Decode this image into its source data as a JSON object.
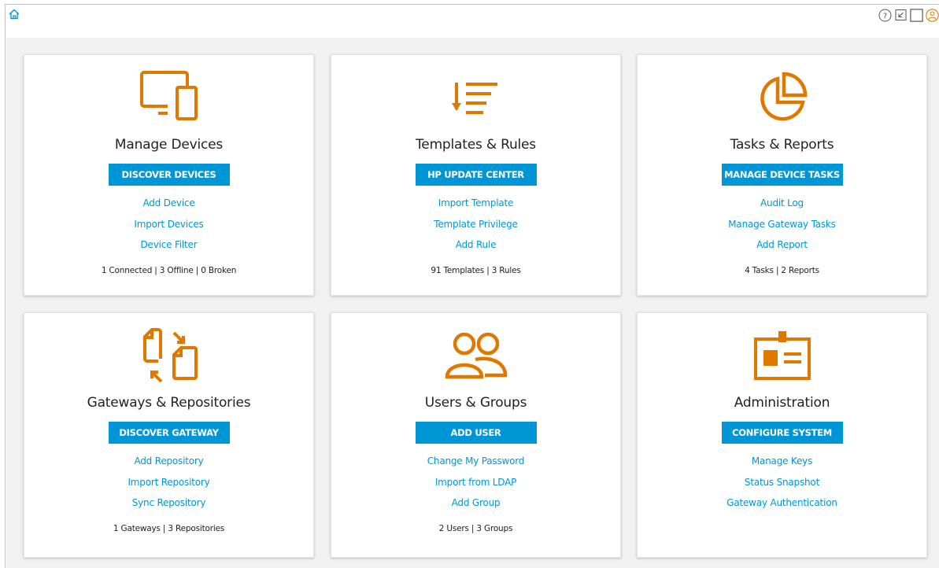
{
  "topbar": {
    "home_icon": "home-icon",
    "right_icons": [
      "help-icon",
      "minimize-icon",
      "window-icon",
      "user-icon"
    ],
    "help_glyph": "?"
  },
  "colors": {
    "accent": "#0096d6",
    "icon_orange": "#e07800",
    "background": "#f1f1f1"
  },
  "cards": [
    {
      "icon": "devices-icon",
      "title": "Manage Devices",
      "action": "DISCOVER DEVICES",
      "links": [
        "Add Device",
        "Import Devices",
        "Device Filter"
      ],
      "stats": "1 Connected | 3 Offline | 0 Broken"
    },
    {
      "icon": "sort-list-icon",
      "title": "Templates & Rules",
      "action": "HP UPDATE CENTER",
      "links": [
        "Import Template",
        "Template Privilege",
        "Add Rule"
      ],
      "stats": "91 Templates | 3 Rules"
    },
    {
      "icon": "pie-chart-icon",
      "title": "Tasks & Reports",
      "action": "MANAGE DEVICE TASKS",
      "links": [
        "Audit Log",
        "Manage Gateway Tasks",
        "Add Report"
      ],
      "stats": "4 Tasks | 2 Reports"
    },
    {
      "icon": "sync-files-icon",
      "title": "Gateways & Repositories",
      "action": "DISCOVER GATEWAY",
      "links": [
        "Add Repository",
        "Import Repository",
        "Sync Repository"
      ],
      "stats": "1 Gateways | 3 Repositories"
    },
    {
      "icon": "users-icon",
      "title": "Users & Groups",
      "action": "ADD USER",
      "links": [
        "Change My Password",
        "Import from LDAP",
        "Add Group"
      ],
      "stats": "2 Users | 3 Groups"
    },
    {
      "icon": "id-badge-icon",
      "title": "Administration",
      "action": "CONFIGURE SYSTEM",
      "links": [
        "Manage Keys",
        "Status Snapshot",
        "Gateway Authentication"
      ],
      "stats": ""
    }
  ]
}
